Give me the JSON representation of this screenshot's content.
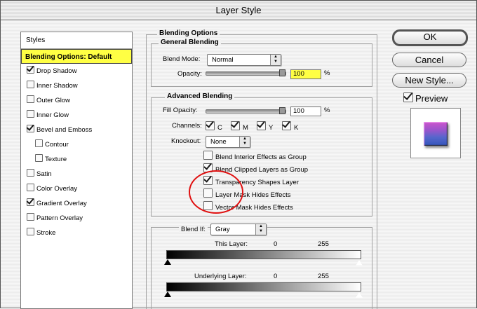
{
  "window": {
    "title": "Layer Style"
  },
  "styles_panel": {
    "header": "Styles",
    "items": [
      {
        "label": "Blending Options: Default",
        "selected": true,
        "has_checkbox": false,
        "checked": false,
        "indent": false
      },
      {
        "label": "Drop Shadow",
        "selected": false,
        "has_checkbox": true,
        "checked": true,
        "indent": false
      },
      {
        "label": "Inner Shadow",
        "selected": false,
        "has_checkbox": true,
        "checked": false,
        "indent": false
      },
      {
        "label": "Outer Glow",
        "selected": false,
        "has_checkbox": true,
        "checked": false,
        "indent": false
      },
      {
        "label": "Inner Glow",
        "selected": false,
        "has_checkbox": true,
        "checked": false,
        "indent": false
      },
      {
        "label": "Bevel and Emboss",
        "selected": false,
        "has_checkbox": true,
        "checked": true,
        "indent": false
      },
      {
        "label": "Contour",
        "selected": false,
        "has_checkbox": true,
        "checked": false,
        "indent": true
      },
      {
        "label": "Texture",
        "selected": false,
        "has_checkbox": true,
        "checked": false,
        "indent": true
      },
      {
        "label": "Satin",
        "selected": false,
        "has_checkbox": true,
        "checked": false,
        "indent": false
      },
      {
        "label": "Color Overlay",
        "selected": false,
        "has_checkbox": true,
        "checked": false,
        "indent": false
      },
      {
        "label": "Gradient Overlay",
        "selected": false,
        "has_checkbox": true,
        "checked": true,
        "indent": false
      },
      {
        "label": "Pattern Overlay",
        "selected": false,
        "has_checkbox": true,
        "checked": false,
        "indent": false
      },
      {
        "label": "Stroke",
        "selected": false,
        "has_checkbox": true,
        "checked": false,
        "indent": false
      }
    ]
  },
  "blending_options": {
    "title": "Blending Options",
    "general": {
      "title": "General Blending",
      "blend_mode_label": "Blend Mode:",
      "blend_mode_value": "Normal",
      "opacity_label": "Opacity:",
      "opacity_value": "100",
      "opacity_unit": "%",
      "opacity_fraction": 1.0
    },
    "advanced": {
      "title": "Advanced Blending",
      "fill_opacity_label": "Fill Opacity:",
      "fill_opacity_value": "100",
      "fill_opacity_unit": "%",
      "fill_opacity_fraction": 1.0,
      "channels_label": "Channels:",
      "channels": [
        {
          "label": "C",
          "checked": true
        },
        {
          "label": "M",
          "checked": true
        },
        {
          "label": "Y",
          "checked": true
        },
        {
          "label": "K",
          "checked": true
        }
      ],
      "knockout_label": "Knockout:",
      "knockout_value": "None",
      "options": [
        {
          "label": "Blend Interior Effects as Group",
          "checked": false
        },
        {
          "label": "Blend Clipped Layers as Group",
          "checked": true
        },
        {
          "label": "Transparency Shapes Layer",
          "checked": true
        },
        {
          "label": "Layer Mask Hides Effects",
          "checked": false
        },
        {
          "label": "Vector Mask Hides Effects",
          "checked": false
        }
      ]
    },
    "blend_if": {
      "label": "Blend If:",
      "value": "Gray",
      "this_layer": {
        "label": "This Layer:",
        "low": "0",
        "high": "255"
      },
      "underlying_layer": {
        "label": "Underlying Layer:",
        "low": "0",
        "high": "255"
      }
    }
  },
  "buttons": {
    "ok": "OK",
    "cancel": "Cancel",
    "new_style": "New Style...",
    "preview_label": "Preview",
    "preview_checked": true
  },
  "colors": {
    "selected_highlight": "#ffff44",
    "annotation_circle": "#e01010"
  }
}
